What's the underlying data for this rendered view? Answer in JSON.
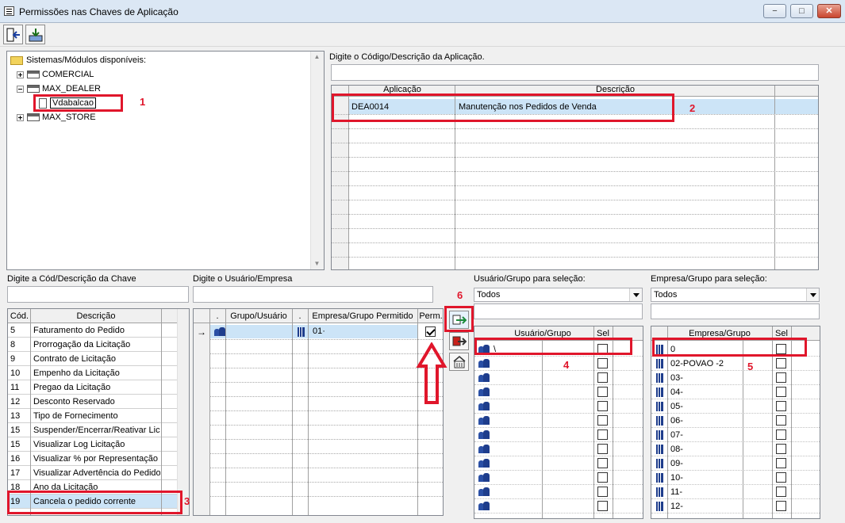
{
  "window": {
    "title": "Permissões nas Chaves de Aplicação",
    "min": "−",
    "max": "□",
    "close": "✕"
  },
  "toolbar": {
    "exit_icon": "exit-door-icon",
    "save_icon": "save-download-icon"
  },
  "tree": {
    "root": "Sistemas/Módulos disponíveis:",
    "items": [
      {
        "label": "COMERCIAL",
        "expander": "plus"
      },
      {
        "label": "MAX_DEALER",
        "expander": "minus"
      },
      {
        "label": "Vdabalcao",
        "selected": true
      },
      {
        "label": "MAX_STORE",
        "expander": "plus"
      }
    ]
  },
  "app_search": {
    "label": "Digite o Código/Descrição da Aplicação.",
    "value": ""
  },
  "app_grid": {
    "columns": [
      "Aplicação",
      "Descrição"
    ],
    "rows": [
      {
        "code": "DEA0014",
        "desc": "Manutenção nos Pedidos de Venda",
        "selected": true
      }
    ]
  },
  "key_search": {
    "label": "Digite a Cód/Descrição da Chave",
    "value": ""
  },
  "user_search": {
    "label": "Digite o Usuário/Empresa",
    "value": ""
  },
  "key_grid": {
    "columns": [
      "Cód.",
      "Descrição"
    ],
    "rows": [
      {
        "cod": "5",
        "desc": "Faturamento do Pedido"
      },
      {
        "cod": "8",
        "desc": "Prorrogação da Licitação"
      },
      {
        "cod": "9",
        "desc": "Contrato de Licitação"
      },
      {
        "cod": "10",
        "desc": "Empenho da Licitação"
      },
      {
        "cod": "11",
        "desc": "Pregao da Licitação"
      },
      {
        "cod": "12",
        "desc": "Desconto Reservado"
      },
      {
        "cod": "13",
        "desc": "Tipo de Fornecimento"
      },
      {
        "cod": "15",
        "desc": "Suspender/Encerrar/Reativar Lic"
      },
      {
        "cod": "15",
        "desc": "Visualizar Log Licitação"
      },
      {
        "cod": "16",
        "desc": "Visualizar % por Representação F"
      },
      {
        "cod": "17",
        "desc": "Visualizar Advertência do Pedido"
      },
      {
        "cod": "18",
        "desc": "Ano da Licitação"
      },
      {
        "cod": "19",
        "desc": "Cancela o pedido corrente",
        "selected": true
      }
    ]
  },
  "perm_grid": {
    "columns": [
      ".",
      "Grupo/Usuário",
      ".",
      "Empresa/Grupo Permitido",
      "Perm."
    ],
    "rows": [
      {
        "empresa": "01·",
        "perm": true
      }
    ]
  },
  "user_select": {
    "label": "Usuário/Grupo para seleção:",
    "value": "Todos",
    "columns": [
      "Usuário/Grupo",
      "Sel"
    ],
    "rows": [
      "\\",
      "",
      "",
      "",
      "",
      "",
      "",
      "",
      "",
      "",
      "",
      ""
    ]
  },
  "emp_select": {
    "label": "Empresa/Grupo para seleção:",
    "value": "Todos",
    "columns": [
      "Empresa/Grupo",
      "Sel"
    ],
    "rows": [
      "0",
      "02-POVAO -2",
      "03-",
      "04-",
      "05-",
      "06-",
      "07-",
      "08-",
      "09-",
      "10-",
      "11-",
      "12-"
    ]
  },
  "annotations": {
    "n1": "1",
    "n2": "2",
    "n3": "3",
    "n4": "4",
    "n5": "5",
    "n6": "6"
  },
  "colors": {
    "annotation": "#e0162b",
    "selection": "#cce4f7",
    "accent": "#1e3d8c"
  }
}
